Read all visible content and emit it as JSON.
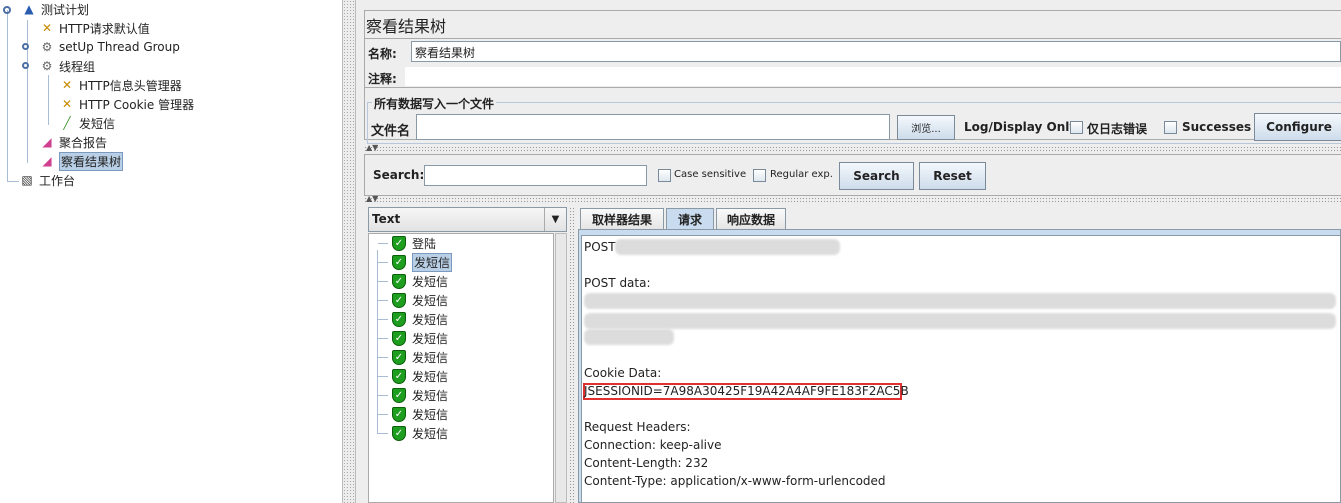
{
  "tree": {
    "items": [
      {
        "label": "测试计划",
        "icon": "flask-icon"
      },
      {
        "label": "HTTP请求默认值",
        "icon": "wrench-icon"
      },
      {
        "label": "setUp Thread Group",
        "icon": "gear-icon"
      },
      {
        "label": "线程组",
        "icon": "gear-icon"
      },
      {
        "label": "HTTP信息头管理器",
        "icon": "wrench-icon"
      },
      {
        "label": "HTTP Cookie 管理器",
        "icon": "wrench-icon"
      },
      {
        "label": "发短信",
        "icon": "pipette-icon"
      },
      {
        "label": "聚合报告",
        "icon": "graph-icon"
      },
      {
        "label": "察看结果树",
        "icon": "graph-icon",
        "selected": true
      },
      {
        "label": "工作台",
        "icon": "notepad-icon"
      }
    ]
  },
  "panel": {
    "title": "察看结果树",
    "name_label": "名称:",
    "name_value": "察看结果树",
    "comment_label": "注释:",
    "comment_value": "",
    "file_group_title": "所有数据写入一个文件",
    "file_label": "文件名",
    "file_value": "",
    "browse_button": "浏览...",
    "log_display_label": "Log/Display Only:",
    "errors_only_label": "仅日志错误",
    "successes_label": "Successes",
    "configure_button": "Configure"
  },
  "search": {
    "label": "Search:",
    "value": "",
    "case_sensitive": "Case sensitive",
    "regex": "Regular exp.",
    "search_button": "Search",
    "reset_button": "Reset"
  },
  "results": {
    "renderer": "Text",
    "items": [
      "登陆",
      "发短信",
      "发短信",
      "发短信",
      "发短信",
      "发短信",
      "发短信",
      "发短信",
      "发短信",
      "发短信",
      "发短信"
    ],
    "selected_index": 1,
    "status_color": "#1e9e1e"
  },
  "tabs": [
    {
      "label": "取样器结果"
    },
    {
      "label": "请求",
      "active": true
    },
    {
      "label": "响应数据"
    }
  ],
  "request": {
    "post_label": "POST",
    "post_data_label": "POST data:",
    "cookie_label": "Cookie Data:",
    "cookie_value": "JSESSIONID=7A98A30425F19A42A4AF9FE183F2AC5B",
    "highlight_color": "#e03030",
    "headers_label": "Request Headers:",
    "headers": [
      "Connection: keep-alive",
      "Content-Length: 232",
      "Content-Type: application/x-www-form-urlencoded"
    ]
  }
}
